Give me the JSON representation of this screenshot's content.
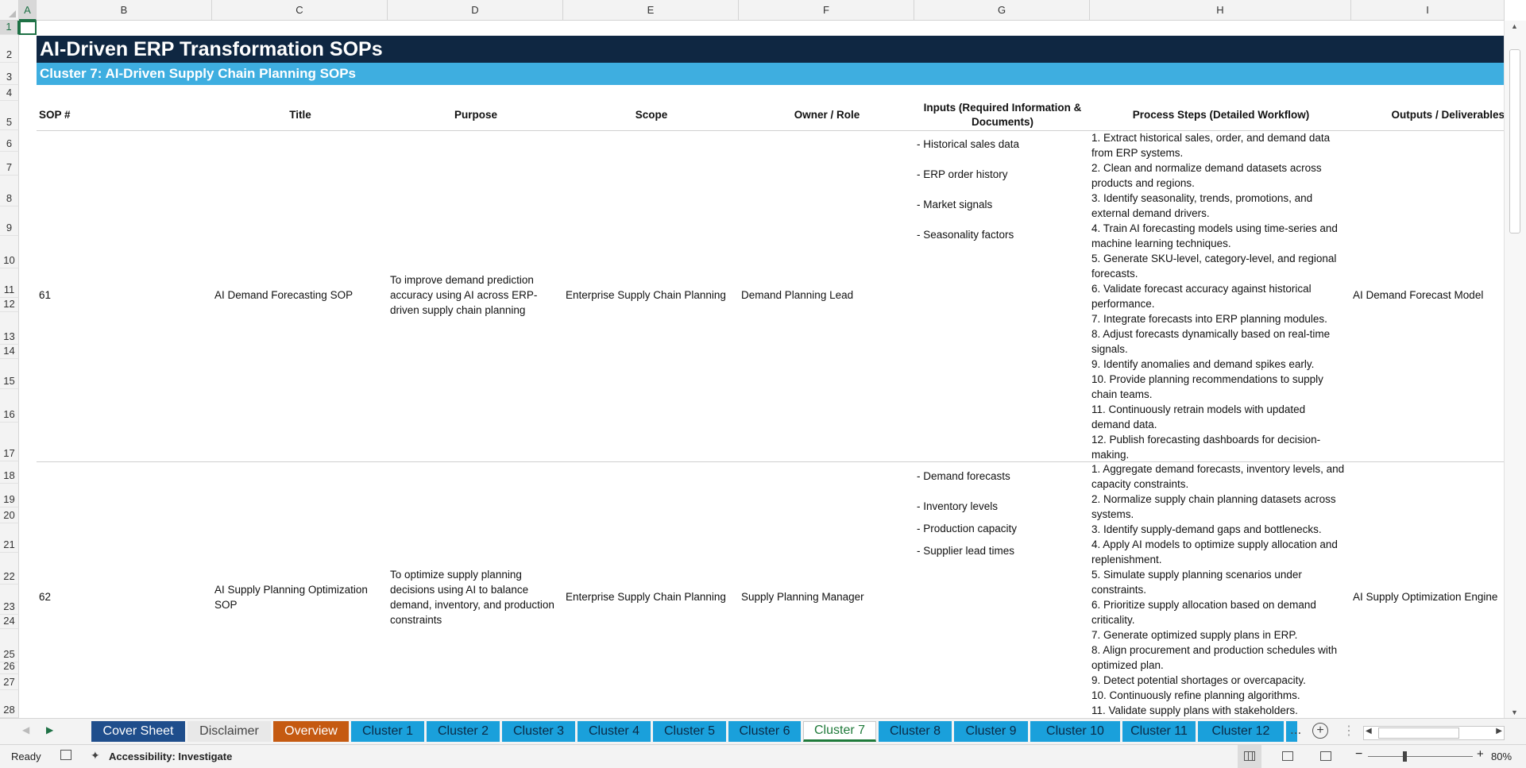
{
  "columns": [
    "A",
    "B",
    "C",
    "D",
    "E",
    "F",
    "G",
    "H",
    "I"
  ],
  "rows": [
    "1",
    "2",
    "3",
    "4",
    "5",
    "6",
    "7",
    "8",
    "9",
    "10",
    "11",
    "12",
    "13",
    "14",
    "15",
    "16",
    "17",
    "18",
    "19",
    "20",
    "21",
    "22",
    "23",
    "24",
    "25",
    "26",
    "27",
    "28"
  ],
  "title": "AI-Driven ERP Transformation SOPs",
  "subtitle": "Cluster 7: AI-Driven Supply Chain Planning SOPs",
  "headers": {
    "sop": "SOP #",
    "title": "Title",
    "purpose": "Purpose",
    "scope": "Scope",
    "owner": "Owner / Role",
    "inputs_1": "Inputs (Required Information &",
    "inputs_2": "Documents)",
    "steps": "Process Steps (Detailed Workflow)",
    "outputs": "Outputs / Deliverables"
  },
  "records": [
    {
      "sop": "61",
      "title": "AI Demand Forecasting SOP",
      "purpose_lines": [
        "To improve demand prediction",
        "accuracy using AI across ERP-",
        "driven supply chain planning"
      ],
      "scope": "Enterprise Supply Chain Planning",
      "owner": "Demand Planning Lead",
      "inputs": [
        "- Historical sales data",
        "- ERP order history",
        "- Market signals",
        "- Seasonality factors"
      ],
      "steps": [
        "1. Extract historical sales, order, and demand data",
        "from ERP systems.",
        "2. Clean and normalize demand datasets across",
        "products and regions.",
        "3. Identify seasonality, trends, promotions, and",
        "external demand drivers.",
        "4. Train AI forecasting models using time-series and",
        "machine learning techniques.",
        "5. Generate SKU-level, category-level, and regional",
        "forecasts.",
        "6. Validate forecast accuracy against historical",
        "performance.",
        "7. Integrate forecasts into ERP planning modules.",
        "8. Adjust forecasts dynamically based on real-time",
        "signals.",
        "9. Identify anomalies and demand spikes early.",
        "10. Provide planning recommendations to supply",
        "chain teams.",
        "11. Continuously retrain models with updated",
        "demand data.",
        "12. Publish forecasting dashboards for decision-",
        "making."
      ],
      "output": "AI Demand Forecast Model"
    },
    {
      "sop": "62",
      "title_lines": [
        "AI Supply Planning Optimization",
        "SOP"
      ],
      "purpose_lines": [
        "To optimize supply planning",
        "decisions using AI to balance",
        "demand, inventory, and production",
        "constraints"
      ],
      "scope": "Enterprise Supply Chain Planning",
      "owner": "Supply Planning Manager",
      "inputs": [
        "- Demand forecasts",
        "- Inventory levels",
        "- Production capacity",
        "- Supplier lead times"
      ],
      "steps": [
        "1. Aggregate demand forecasts, inventory levels, and",
        "capacity constraints.",
        "2. Normalize supply chain planning datasets across",
        "systems.",
        "3. Identify supply-demand gaps and bottlenecks.",
        "4. Apply AI models to optimize supply allocation and",
        "replenishment.",
        "5. Simulate supply planning scenarios under",
        "constraints.",
        "6. Prioritize supply allocation based on demand",
        "criticality.",
        "7. Generate optimized supply plans in ERP.",
        "8. Align procurement and production schedules with",
        "optimized plan.",
        "9. Detect potential shortages or overcapacity.",
        "10. Continuously refine planning algorithms.",
        "11. Validate supply plans with stakeholders."
      ],
      "output": "AI Supply Optimization Engine"
    }
  ],
  "tabs": [
    {
      "label": "Cover Sheet",
      "color": "#1f4e8c",
      "text": "#ffffff"
    },
    {
      "label": "Disclaimer",
      "color": "#e8e8e8",
      "text": "#444444"
    },
    {
      "label": "Overview",
      "color": "#c55a11",
      "text": "#ffffff"
    },
    {
      "label": "Cluster 1",
      "color": "#1aa0db",
      "text": "#0b2a45"
    },
    {
      "label": "Cluster 2",
      "color": "#1aa0db",
      "text": "#0b2a45"
    },
    {
      "label": "Cluster 3",
      "color": "#1aa0db",
      "text": "#0b2a45"
    },
    {
      "label": "Cluster 4",
      "color": "#1aa0db",
      "text": "#0b2a45"
    },
    {
      "label": "Cluster 5",
      "color": "#1aa0db",
      "text": "#0b2a45"
    },
    {
      "label": "Cluster 6",
      "color": "#1aa0db",
      "text": "#0b2a45"
    },
    {
      "label": "Cluster 7",
      "color": "#ffffff",
      "text": "#1f7a3a"
    },
    {
      "label": "Cluster 8",
      "color": "#1aa0db",
      "text": "#0b2a45"
    },
    {
      "label": "Cluster 9",
      "color": "#1aa0db",
      "text": "#0b2a45"
    },
    {
      "label": "Cluster 10",
      "color": "#1aa0db",
      "text": "#0b2a45"
    },
    {
      "label": "Cluster 11",
      "color": "#1aa0db",
      "text": "#0b2a45"
    },
    {
      "label": "Cluster 12",
      "color": "#1aa0db",
      "text": "#0b2a45"
    }
  ],
  "status": {
    "ready": "Ready",
    "accessibility": "Accessibility: Investigate",
    "zoom": "80%",
    "more": "..."
  }
}
